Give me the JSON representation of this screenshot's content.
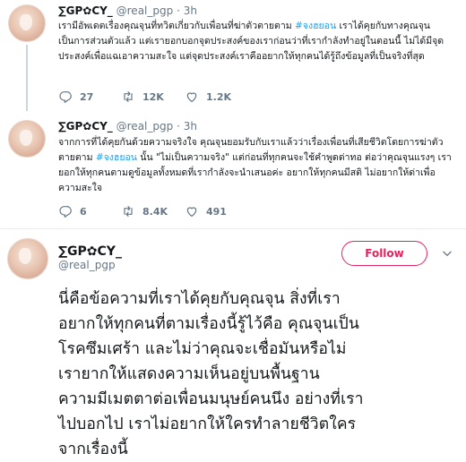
{
  "tweets": [
    {
      "name": "∑GP✿CY_",
      "handle": "@real_pgp",
      "separator": "·",
      "time": "3h",
      "text_before": "เรามีอัพเดตเรื่องคุณจุนที่ทวิตเกี่ยวกับเพื่อนที่ฆ่าตัวตายตาม ",
      "hashtag": "#จงฮยอน",
      "text_after": " เราได้คุยกับทางคุณจุนเป็นการส่วนตัวแล้ว แต่เรายอกบอกจุดประสงค์ของเราก่อนว่าที่เรากำลังทำอยู่ในตอนนี้ ไม่ได้มีจุดประสงค์เพื่อแฉเอาความสะใจ แต่จุดประสงค์เราคืออยากให้ทุกคนได้รู้ถึงข้อมูลที่เป็นจริงที่สุด",
      "replies": "27",
      "retweets": "12K",
      "likes": "1.2K"
    },
    {
      "name": "∑GP✿CY_",
      "handle": "@real_pgp",
      "separator": "·",
      "time": "3h",
      "text_before": "จากการที่ได้คุยกันด้วยความจริงใจ คุณจุนยอมรับกับเราแล้วว่าเรื่องเพื่อนที่เสียชีวิตโดยการฆ่าตัวตายตาม ",
      "hashtag": "#จงฮยอน",
      "text_after": " นั้น \"ไม่เป็นความจริง\" แต่ก่อนที่ทุกคนจะใช้คำพูดด่าทอ ต่อว่าคุณจุนแรงๆ เรายอกให้ทุกคนตามดูข้อมูลทั้งหมดที่เรากำลังจะนำเสนอค่ะ อยากให้ทุกคนมีสติ ไม่อยากให้ด่าเพื่อความสะใจ",
      "replies": "6",
      "retweets": "8.4K",
      "likes": "491"
    }
  ],
  "main_tweet": {
    "name": "∑GP✿CY_",
    "handle": "@real_pgp",
    "follow_label": "Follow",
    "lines": [
      "นี่คือข้อความที่เราได้คุยกับคุณจุน สิ่งที่เรา",
      "อยากให้ทุกคนที่ตามเรื่องนี้รู้ไว้คือ คุณจุนเป็น",
      "โรคซึมเศร้า และไม่ว่าคุณจะเชื่อมันหรือไม่",
      "เรายากให้แสดงความเห็นอยู่บนพื้นฐาน",
      "ความมีเมตตาต่อเพื่อนมนุษย์คนนึง อย่างที่เรา",
      "ไปบอกไป เราไม่อยากให้ใครทำลายชีวิตใคร",
      "จากเรื่องนี้"
    ]
  },
  "colors": {
    "retweet_green": "#17bf63",
    "like_red": "#e0245e",
    "hashtag_blue": "#1da1f2",
    "secondary_gray": "#657786"
  },
  "icons": [
    "reply-icon",
    "retweet-icon",
    "like-icon",
    "chevron-down-icon"
  ]
}
